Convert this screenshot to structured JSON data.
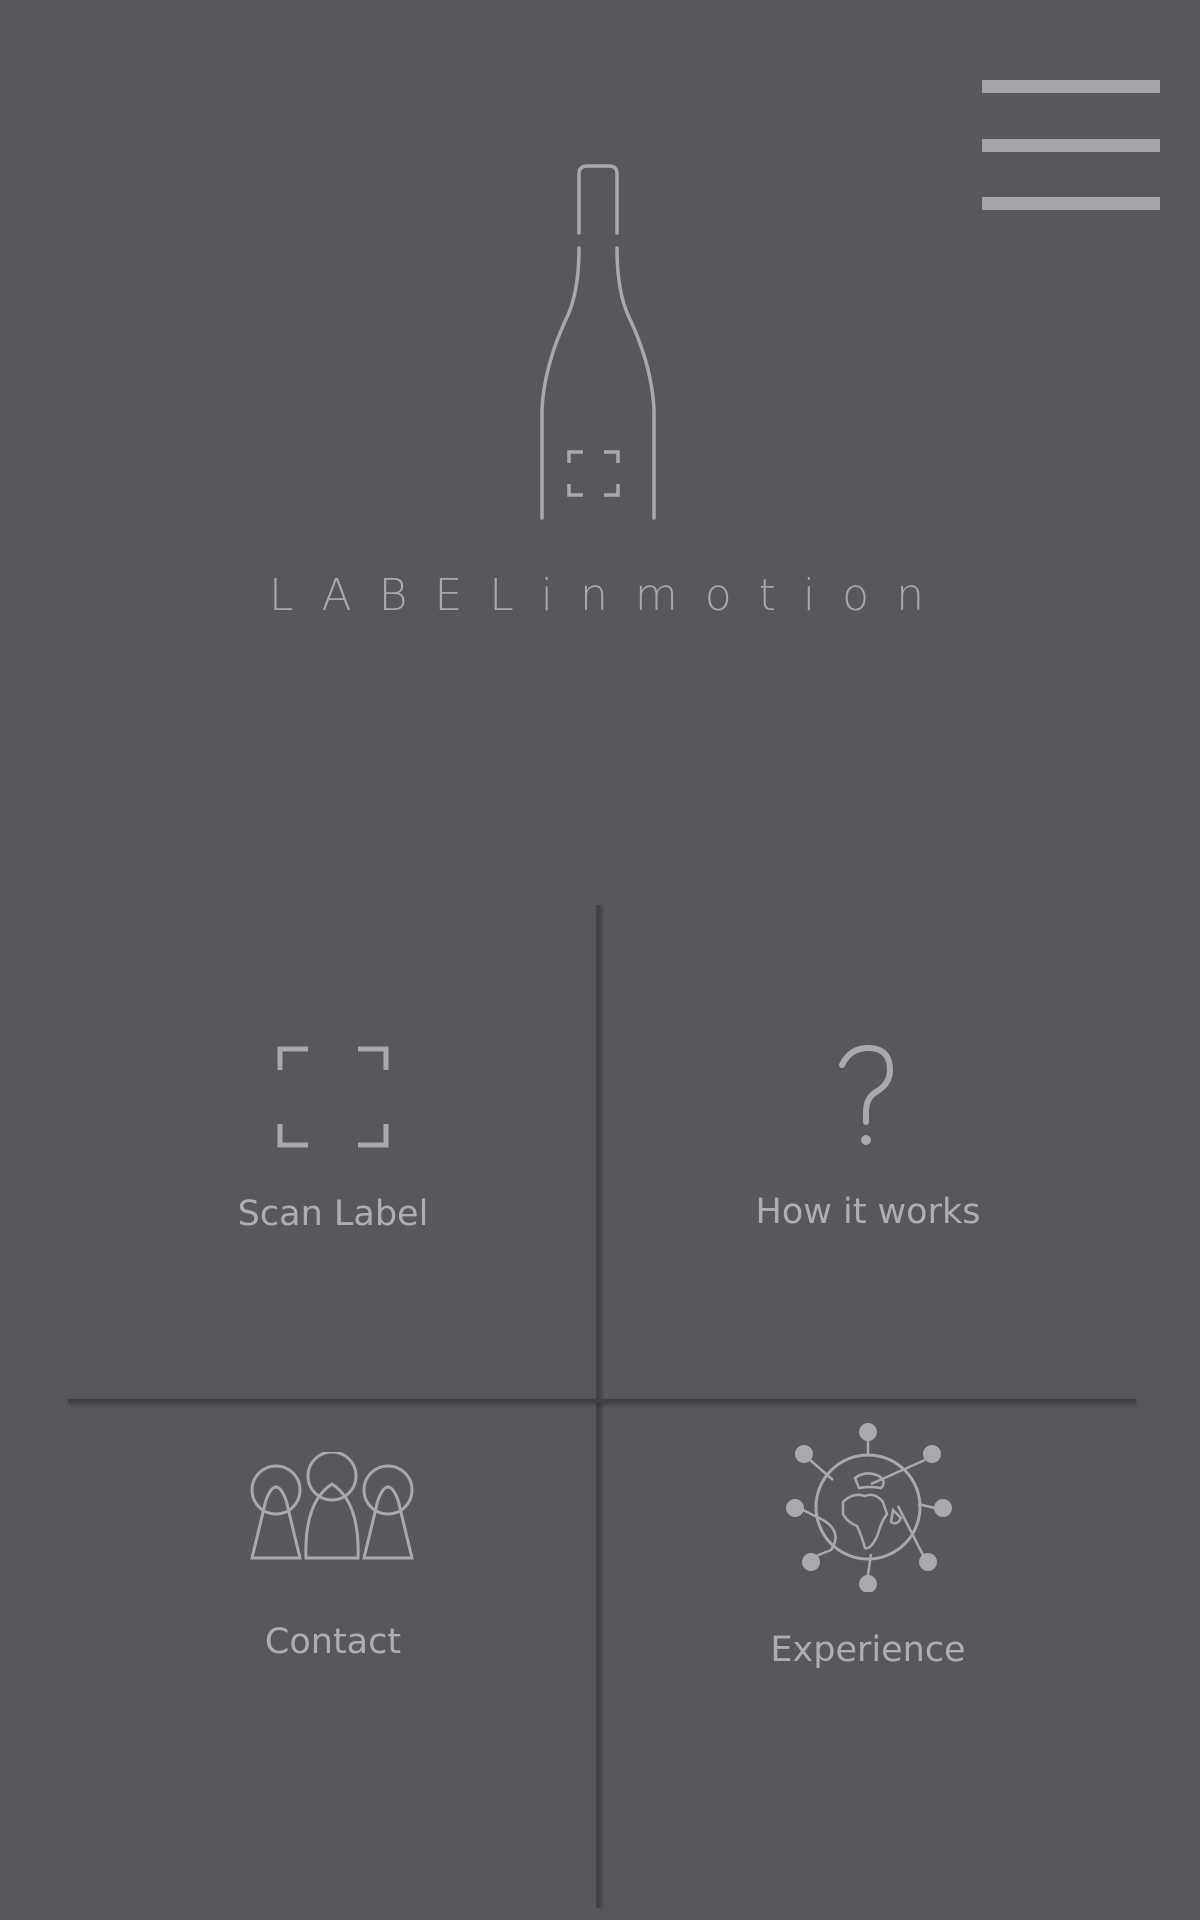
{
  "header": {
    "menu_icon": "hamburger-menu-icon",
    "logo_icon": "wine-bottle-scan-icon",
    "brand_name": "LABELinmotion"
  },
  "tiles": [
    {
      "id": "scan-label",
      "label": "Scan Label",
      "icon": "scan-frame-icon"
    },
    {
      "id": "how-it-works",
      "label": "How it works",
      "icon": "question-mark-icon"
    },
    {
      "id": "contact",
      "label": "Contact",
      "icon": "people-icon"
    },
    {
      "id": "experience",
      "label": "Experience",
      "icon": "globe-network-icon"
    }
  ],
  "theme": {
    "background": "#58575c",
    "foreground": "#a9a9ab",
    "divider": "#414145"
  }
}
